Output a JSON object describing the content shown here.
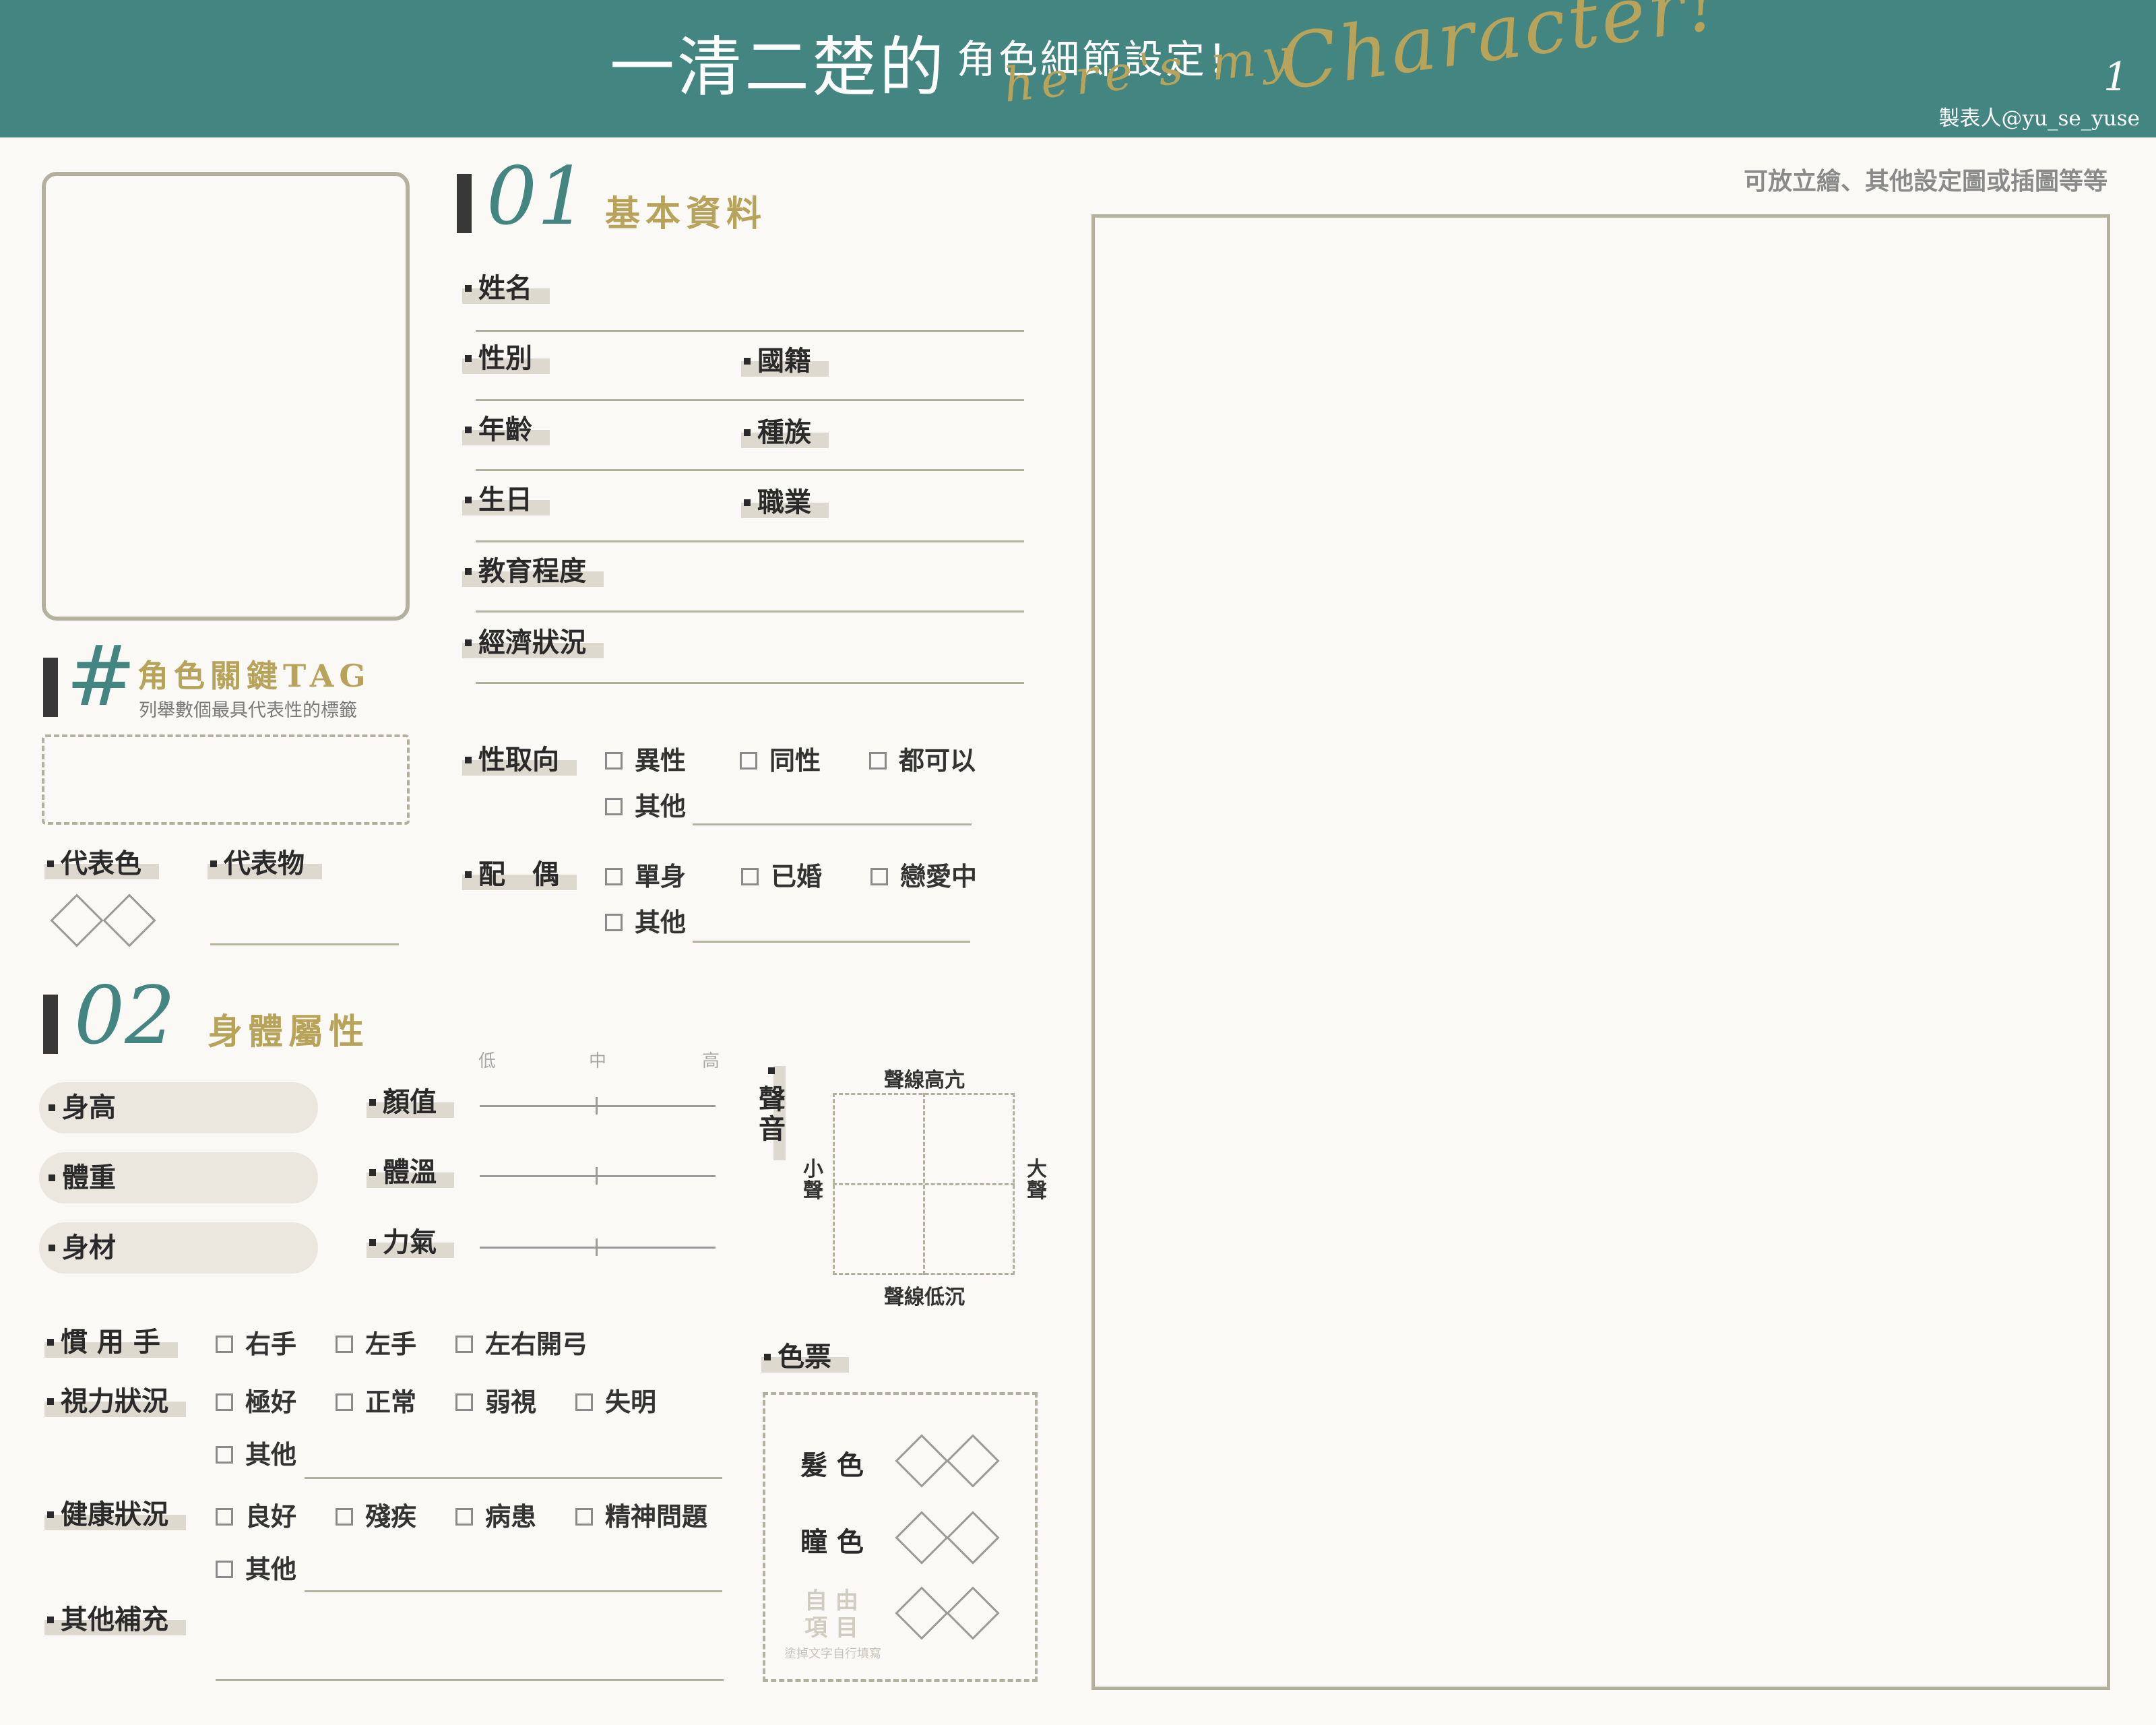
{
  "header": {
    "title_main": "一清二楚的",
    "title_sub": "角色細節設定！",
    "script_1": "here's my",
    "script_2": "Character!",
    "page_number": "1",
    "maker": "製表人@yu_se_yuse"
  },
  "right_panel": {
    "note": "可放立繪、其他設定圖或插圖等等"
  },
  "section_01": {
    "number": "01",
    "title": "基本資料",
    "fields": {
      "name": "姓名",
      "gender": "性別",
      "nationality": "國籍",
      "age": "年齡",
      "race": "種族",
      "birthday": "生日",
      "occupation": "職業",
      "education": "教育程度",
      "economy": "經濟狀況"
    },
    "orientation": {
      "label": "性取向",
      "options": [
        "異性",
        "同性",
        "都可以",
        "其他"
      ]
    },
    "partner": {
      "label": "配　偶",
      "options": [
        "單身",
        "已婚",
        "戀愛中",
        "其他"
      ]
    }
  },
  "tag_section": {
    "hash": "#",
    "title": "角色關鍵TAG",
    "subtitle": "列舉數個最具代表性的標籤",
    "rep_color": "代表色",
    "rep_item": "代表物"
  },
  "section_02": {
    "number": "02",
    "title": "身體屬性",
    "pills": [
      "身高",
      "體重",
      "身材"
    ],
    "scale": {
      "low": "低",
      "mid": "中",
      "high": "高"
    },
    "sliders": [
      "顏值",
      "體溫",
      "力氣"
    ],
    "voice": {
      "label": "聲音",
      "top": "聲線高亢",
      "bottom": "聲線低沉",
      "left": "小聲",
      "right": "大聲"
    },
    "handedness": {
      "label": "慣 用 手",
      "options": [
        "右手",
        "左手",
        "左右開弓"
      ]
    },
    "vision": {
      "label": "視力狀況",
      "options": [
        "極好",
        "正常",
        "弱視",
        "失明",
        "其他"
      ]
    },
    "health": {
      "label": "健康狀況",
      "options": [
        "良好",
        "殘疾",
        "病患",
        "精神問題",
        "其他"
      ]
    },
    "other": {
      "label": "其他補充"
    },
    "color_chart": {
      "label": "色票",
      "hair": "髮 色",
      "eye": "瞳 色",
      "free_1": "自 由",
      "free_2": "項 目",
      "free_note": "塗掉文字自行填寫"
    }
  }
}
